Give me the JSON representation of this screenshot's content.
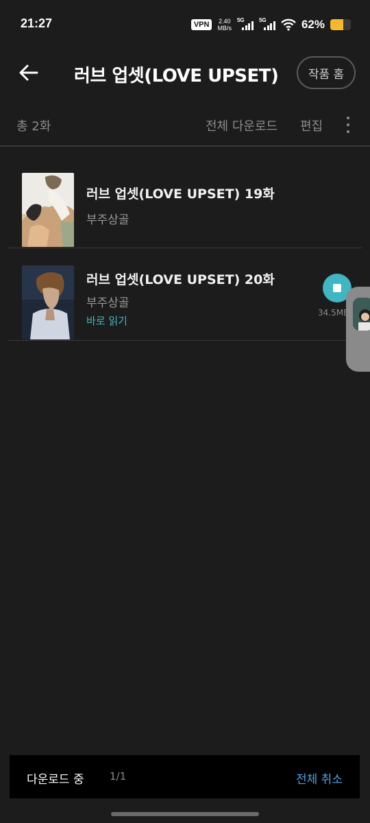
{
  "status_bar": {
    "time": "21:27",
    "vpn": "VPN",
    "net_speed_value": "2.40",
    "net_speed_unit": "MB/s",
    "signal1_tag": "5G",
    "signal2_tag": "5G",
    "battery": "62%",
    "battery_level": 0.62
  },
  "header": {
    "title": "러브 업셋(LOVE UPSET)",
    "home_button": "작품 홈"
  },
  "toolbar": {
    "total": "총 2화",
    "download_all": "전체 다운로드",
    "edit": "편집"
  },
  "episodes": [
    {
      "title": "러브 업셋(LOVE UPSET) 19화",
      "author": "부주상골"
    },
    {
      "title": "러브 업셋(LOVE UPSET) 20화",
      "author": "부주상골",
      "read_now": "바로 읽기",
      "size": "34.5MB"
    }
  ],
  "download_bar": {
    "label": "다운로드 중",
    "count": "1/1",
    "cancel_all": "전체 취소"
  },
  "colors": {
    "accent_teal": "#3fb6c2",
    "link_blue": "#4aa5e8",
    "battery": "#f5b82e"
  }
}
